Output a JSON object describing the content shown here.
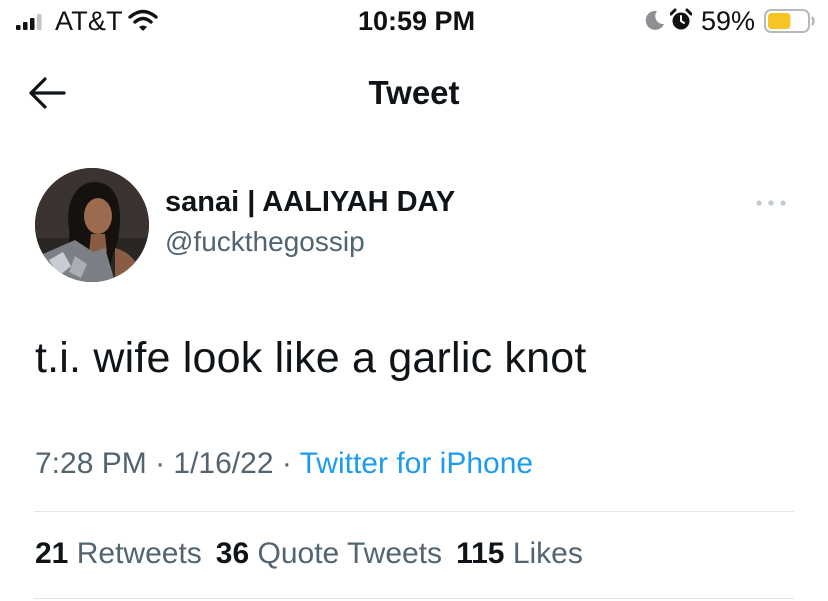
{
  "status_bar": {
    "carrier": "AT&T",
    "time": "10:59 PM",
    "battery_percent": "59%",
    "battery_level": 0.59,
    "battery_color": "#f7c325"
  },
  "header": {
    "title": "Tweet",
    "back_icon": "arrow-left-icon"
  },
  "tweet": {
    "author": {
      "display_name": "sanai | AALIYAH DAY",
      "handle": "@fuckthegossip"
    },
    "more_icon": "more-horizontal-icon",
    "text": "t.i. wife look like a garlic knot",
    "time": "7:28 PM",
    "date": "1/16/22",
    "source": "Twitter for iPhone",
    "stats": {
      "retweets_count": "21",
      "retweets_label": "Retweets",
      "quote_tweets_count": "36",
      "quote_tweets_label": "Quote Tweets",
      "likes_count": "115",
      "likes_label": "Likes"
    }
  },
  "colors": {
    "link": "#1d9bf0",
    "secondary_text": "#536471",
    "primary_text": "#0f1419"
  }
}
